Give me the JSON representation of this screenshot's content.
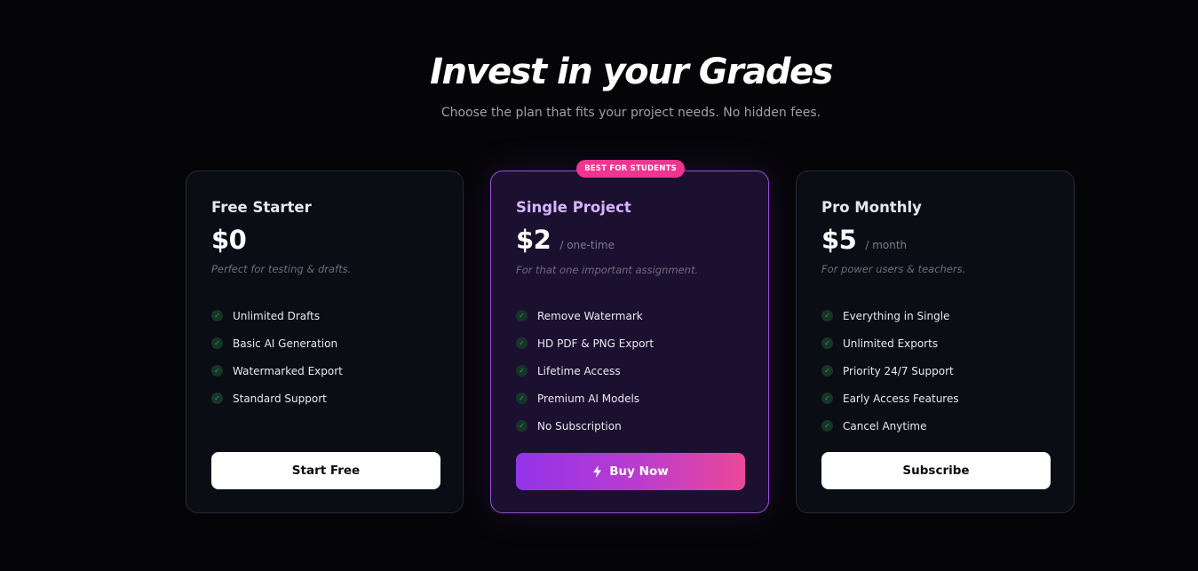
{
  "header": {
    "title": "Invest in your Grades",
    "subtitle": "Choose the plan that fits your project needs. No hidden fees."
  },
  "plans": [
    {
      "name": "Free Starter",
      "price": "$0",
      "period": "",
      "description": "Perfect for testing & drafts.",
      "features": [
        "Unlimited Drafts",
        "Basic AI Generation",
        "Watermarked Export",
        "Standard Support"
      ],
      "cta": "Start Free"
    },
    {
      "badge": "BEST FOR STUDENTS",
      "name": "Single Project",
      "price": "$2",
      "period": "/ one-time",
      "description": "For that one important assignment.",
      "features": [
        "Remove Watermark",
        "HD PDF & PNG Export",
        "Lifetime Access",
        "Premium AI Models",
        "No Subscription"
      ],
      "cta": "Buy Now",
      "cta_icon": "lightning-bolt-icon"
    },
    {
      "name": "Pro Monthly",
      "price": "$5",
      "period": "/ month",
      "description": "For power users & teachers.",
      "features": [
        "Everything in Single",
        "Unlimited Exports",
        "Priority 24/7 Support",
        "Early Access Features",
        "Cancel Anytime"
      ],
      "cta": "Subscribe"
    }
  ],
  "icons": {
    "feature_check": "check-icon"
  },
  "colors": {
    "background": "#050507",
    "card": "#0a0d14",
    "featured_card": "#1b1030",
    "featured_border": "#9b4ddb",
    "badge": "#f0348f",
    "featured_name": "#d8b4fe",
    "gradient_start": "#9333ea",
    "gradient_end": "#ec4899",
    "check": "#2f9e63"
  }
}
